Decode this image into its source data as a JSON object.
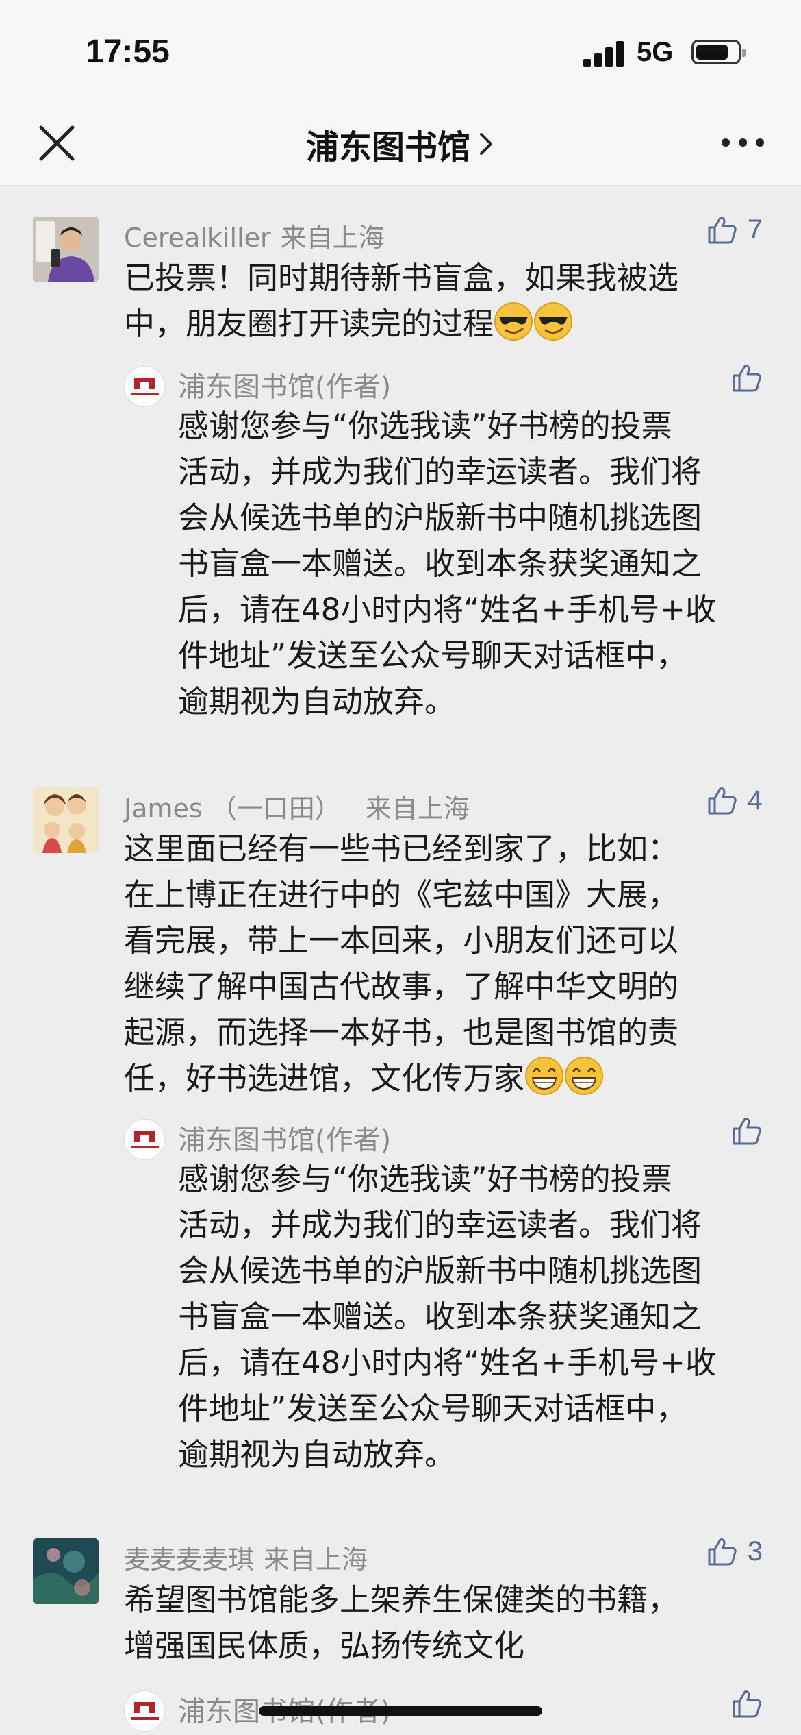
{
  "status_bar": {
    "time": "17:55",
    "network": "5G"
  },
  "nav": {
    "title": "浦东图书馆",
    "close_icon": "close-icon",
    "more_icon": "more-dots-icon"
  },
  "comments": [
    {
      "name": "Cerealkiller",
      "location": "来自上海",
      "likes": "7",
      "text_lines": [
        "已投票！同时期待新书盲盒，如果我被选",
        "中，朋友圈打开读完的过程"
      ],
      "emoji": [
        "sunglasses-emoji",
        "sunglasses-emoji"
      ],
      "reply": {
        "author": "浦东图书馆(作者)",
        "text_lines": [
          "感谢您参与“你选我读”好书榜的投票",
          "活动，并成为我们的幸运读者。我们将",
          "会从候选书单的沪版新书中随机挑选图",
          "书盲盒一本赠送。收到本条获奖通知之",
          "后，请在48小时内将“姓名+手机号+收",
          "件地址”发送至公众号聊天对话框中，",
          "逾期视为自动放弃。"
        ]
      }
    },
    {
      "name": "James （一口田）",
      "location": "来自上海",
      "likes": "4",
      "text_lines": [
        "这里面已经有一些书已经到家了，比如：",
        "在上博正在进行中的《宅兹中国》大展，",
        "看完展，带上一本回来，小朋友们还可以",
        "继续了解中国古代故事，了解中华文明的",
        "起源，而选择一本好书，也是图书馆的责",
        "任，好书选进馆，文化传万家"
      ],
      "emoji": [
        "grinning-emoji",
        "grinning-emoji"
      ],
      "reply": {
        "author": "浦东图书馆(作者)",
        "text_lines": [
          "感谢您参与“你选我读”好书榜的投票",
          "活动，并成为我们的幸运读者。我们将",
          "会从候选书单的沪版新书中随机挑选图",
          "书盲盒一本赠送。收到本条获奖通知之",
          "后，请在48小时内将“姓名+手机号+收",
          "件地址”发送至公众号聊天对话框中，",
          "逾期视为自动放弃。"
        ]
      }
    },
    {
      "name": "麦麦麦麦琪",
      "location": "来自上海",
      "likes": "3",
      "text_lines": [
        "希望图书馆能多上架养生保健类的书籍，",
        "增强国民体质，弘扬传统文化"
      ],
      "reply": {
        "author": "浦东图书馆(作者)"
      }
    }
  ]
}
